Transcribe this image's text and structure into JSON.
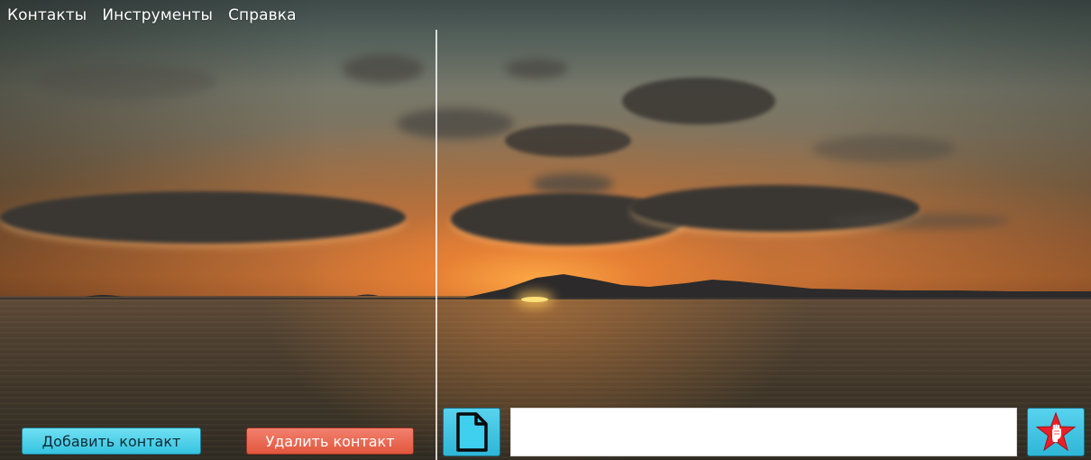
{
  "menu": {
    "items": [
      {
        "label": "Контакты"
      },
      {
        "label": "Инструменты"
      },
      {
        "label": "Справка"
      }
    ]
  },
  "contacts": {
    "add_button_label": "Добавить контакт",
    "delete_button_label": "Удалить контакт"
  },
  "chat": {
    "message_input_value": "",
    "attach_icon": "file-icon",
    "send_icon": "red-star-fist-icon"
  },
  "colors": {
    "add_button": "#35c3e0",
    "delete_button": "#e2573e",
    "icon_button": "#2fb6d6",
    "star": "#e8202a"
  }
}
